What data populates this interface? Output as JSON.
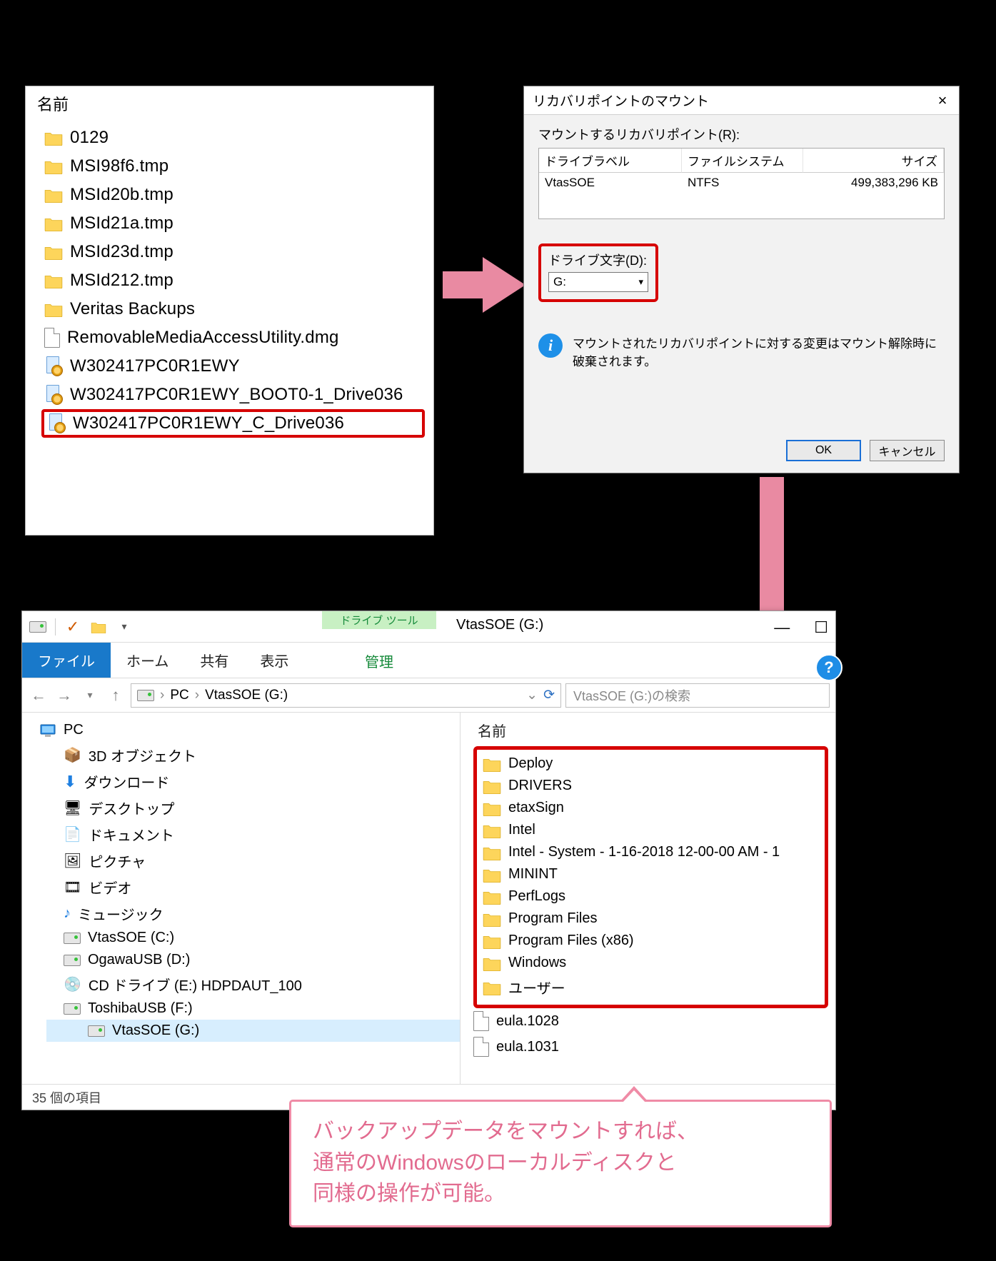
{
  "listPanel": {
    "header": "名前",
    "items": [
      {
        "icon": "folder",
        "name": "0129"
      },
      {
        "icon": "folder",
        "name": "MSI98f6.tmp"
      },
      {
        "icon": "folder",
        "name": "MSId20b.tmp"
      },
      {
        "icon": "folder",
        "name": "MSId21a.tmp"
      },
      {
        "icon": "folder",
        "name": "MSId23d.tmp"
      },
      {
        "icon": "folder",
        "name": "MSId212.tmp"
      },
      {
        "icon": "folder",
        "name": "Veritas Backups"
      },
      {
        "icon": "page",
        "name": "RemovableMediaAccessUtility.dmg"
      },
      {
        "icon": "v2i",
        "name": "W302417PC0R1EWY"
      },
      {
        "icon": "v2i",
        "name": "W302417PC0R1EWY_BOOT0-1_Drive036"
      },
      {
        "icon": "v2i",
        "name": "W302417PC0R1EWY_C_Drive036",
        "selected": true
      }
    ]
  },
  "dialog": {
    "title": "リカバリポイントのマウント",
    "close": "×",
    "mountLabel": "マウントするリカバリポイント(R):",
    "grid": {
      "headers": {
        "label": "ドライブラベル",
        "fs": "ファイルシステム",
        "size": "サイズ"
      },
      "row": {
        "label": "VtasSOE",
        "fs": "NTFS",
        "size": "499,383,296 KB"
      }
    },
    "driveLetterLabel": "ドライブ文字(D):",
    "driveLetterValue": "G:",
    "infoText": "マウントされたリカバリポイントに対する変更はマウント解除時に破棄されます。",
    "ok": "OK",
    "cancel": "キャンセル"
  },
  "explorer": {
    "toolsLabel": "ドライブ ツール",
    "title": "VtasSOE (G:)",
    "tabs": {
      "file": "ファイル",
      "home": "ホーム",
      "share": "共有",
      "view": "表示",
      "manage": "管理"
    },
    "breadcrumb": {
      "pc": "PC",
      "loc": "VtasSOE (G:)"
    },
    "searchPlaceholder": "VtasSOE (G:)の検索",
    "nav": {
      "pc": "PC",
      "items": [
        "3D オブジェクト",
        "ダウンロード",
        "デスクトップ",
        "ドキュメント",
        "ピクチャ",
        "ビデオ",
        "ミュージック",
        "VtasSOE (C:)",
        "OgawaUSB (D:)",
        "CD ドライブ (E:) HDPDAUT_100",
        "ToshibaUSB (F:)",
        "VtasSOE (G:)"
      ]
    },
    "contentHeader": "名前",
    "folders": [
      "Deploy",
      "DRIVERS",
      "etaxSign",
      "Intel",
      "Intel - System - 1-16-2018 12-00-00 AM - 1",
      "MININT",
      "PerfLogs",
      "Program Files",
      "Program Files (x86)",
      "Windows",
      "ユーザー"
    ],
    "extraFiles": [
      "eula.1028",
      "eula.1031"
    ],
    "status": "35 個の項目"
  },
  "callout": {
    "l1": "バックアップデータをマウントすれば、",
    "l2": "通常のWindowsのローカルディスクと",
    "l3": "同様の操作が可能。"
  }
}
